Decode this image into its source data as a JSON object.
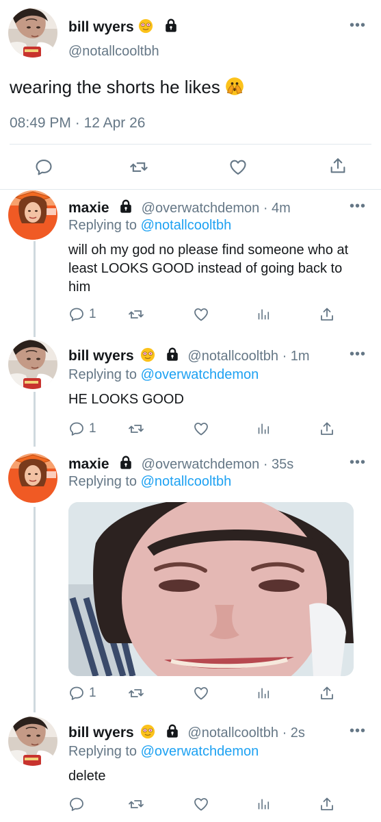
{
  "main_tweet": {
    "name": "bill wyers",
    "handle": "@notallcooltbh",
    "text": "wearing the shorts he likes",
    "time": "08:49 PM",
    "separator": "·",
    "date": "12 Apr 26",
    "more": "•••"
  },
  "replies": [
    {
      "name": "maxie",
      "handle": "@overwatchdemon",
      "age": "· 4m",
      "replying_label": "Replying to",
      "replying_to": "@notallcooltbh",
      "text": "will oh my god no please find someone who at least LOOKS GOOD instead of going back to him",
      "reply_count": "1",
      "more": "•••"
    },
    {
      "name": "bill wyers",
      "handle": "@notallcooltbh",
      "age": "· 1m",
      "replying_label": "Replying to",
      "replying_to": "@overwatchdemon",
      "text": "HE LOOKS GOOD",
      "reply_count": "1",
      "more": "•••"
    },
    {
      "name": "maxie",
      "handle": "@overwatchdemon",
      "age": "· 35s",
      "replying_label": "Replying to",
      "replying_to": "@notallcooltbh",
      "reply_count": "1",
      "more": "•••"
    },
    {
      "name": "bill wyers",
      "handle": "@notallcooltbh",
      "age": "· 2s",
      "replying_label": "Replying to",
      "replying_to": "@overwatchdemon",
      "text": "delete",
      "more": "•••"
    }
  ],
  "icons": {
    "reply": "reply-icon",
    "retweet": "retweet-icon",
    "like": "heart-icon",
    "share": "share-icon",
    "analytics": "analytics-icon",
    "lock": "lock-icon",
    "emoji_smitten": "smiling-face-with-heart-eyes-emoji",
    "emoji_peek": "face-with-peeking-eye-emoji"
  },
  "colors": {
    "text": "#14171a",
    "muted": "#657786",
    "link": "#1da1f2",
    "divider": "#e1e8ed",
    "thread_line": "#cfd9de"
  }
}
